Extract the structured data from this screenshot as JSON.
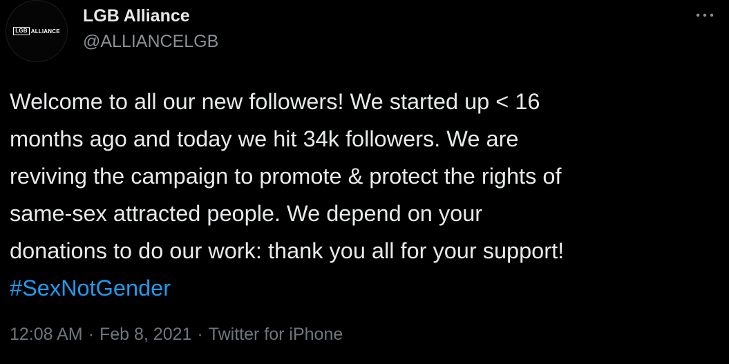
{
  "author": {
    "avatar_logo_box": "LGB",
    "avatar_logo_text": "ALLIANCE",
    "display_name": "LGB Alliance",
    "handle": "@ALLIANCELGB"
  },
  "more_icon": "more-horizontal-icon",
  "tweet": {
    "lines": [
      "Welcome to all our new followers! We started up < 16",
      "months ago and today we hit 34k followers. We are",
      "reviving the campaign to promote & protect the rights of",
      "same-sex attracted people. We depend on your",
      "donations to do our work: thank you all for your support!"
    ],
    "hashtag": "#SexNotGender"
  },
  "meta": {
    "time": "12:08 AM",
    "separator": "·",
    "date": "Feb 8, 2021",
    "source": "Twitter for iPhone"
  },
  "colors": {
    "background": "#000000",
    "text": "#e7e9ea",
    "secondary": "#8b9096",
    "link": "#1d9bf0"
  }
}
